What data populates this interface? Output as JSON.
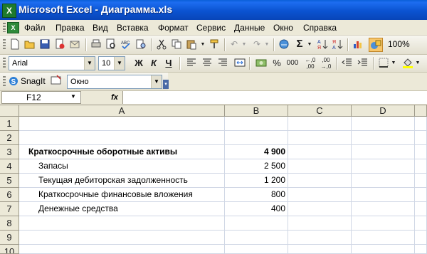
{
  "window": {
    "title": "Microsoft Excel - Диаграмма.xls",
    "app_icon_letter": "X"
  },
  "menu": {
    "items": [
      "Файл",
      "Правка",
      "Вид",
      "Вставка",
      "Формат",
      "Сервис",
      "Данные",
      "Окно",
      "Справка"
    ]
  },
  "toolbar_standard": {
    "icons": [
      "new-icon",
      "open-icon",
      "save-icon",
      "permission-icon",
      "email-icon",
      "print-icon",
      "print-preview-icon",
      "spelling-icon",
      "research-icon",
      "cut-icon",
      "copy-icon",
      "paste-icon",
      "format-painter-icon",
      "undo-icon",
      "redo-icon",
      "hyperlink-icon",
      "autosum-icon",
      "sort-asc-icon",
      "sort-desc-icon",
      "chart-wizard-icon",
      "drawing-icon"
    ],
    "zoom": "100%",
    "autosum_glyph": "Σ"
  },
  "toolbar_formatting": {
    "font": "Arial",
    "size": "10",
    "bold": "Ж",
    "italic": "К",
    "underline": "Ч",
    "percent": "%",
    "thousands": "000"
  },
  "toolbar_snagit": {
    "snagit_label": "SnagIt",
    "target_value": "Окно"
  },
  "formula_bar": {
    "name_box": "F12",
    "fx": "fx",
    "content": ""
  },
  "sheet": {
    "columns": [
      "A",
      "B",
      "C",
      "D"
    ],
    "rows": [
      {
        "n": "1",
        "a": "",
        "b": ""
      },
      {
        "n": "2",
        "a": "",
        "b": ""
      },
      {
        "n": "3",
        "a": "Краткосрочные оборотные активы",
        "b": "4 900",
        "bold": true
      },
      {
        "n": "4",
        "a": "Запасы",
        "b": "2 500"
      },
      {
        "n": "5",
        "a": "Текущая дебиторская задолженность",
        "b": "1 200"
      },
      {
        "n": "6",
        "a": "Краткосрочные финансовые вложения",
        "b": "800"
      },
      {
        "n": "7",
        "a": "Денежные средства",
        "b": "400"
      },
      {
        "n": "8",
        "a": "",
        "b": ""
      },
      {
        "n": "9",
        "a": "",
        "b": ""
      },
      {
        "n": "10",
        "a": "",
        "b": ""
      }
    ]
  },
  "colors": {
    "titlebar": "#0b53d1",
    "chrome": "#ece9d8",
    "gridline": "#d0d7e5"
  }
}
